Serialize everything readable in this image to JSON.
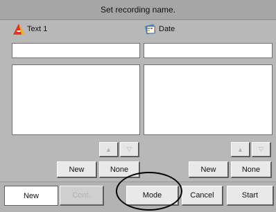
{
  "title": "Set recording name.",
  "left_panel": {
    "label": "Text 1",
    "icon": "text-font-icon",
    "new_label": "New",
    "none_label": "None",
    "up_arrow": "▲",
    "down_arrow": "▽"
  },
  "right_panel": {
    "label": "Date",
    "icon": "calendar-icon",
    "new_label": "New",
    "none_label": "None",
    "up_arrow": "▲",
    "down_arrow": "▽"
  },
  "bottom": {
    "new_label": "New",
    "cont_label": "Cont.",
    "mode_label": "Mode",
    "cancel_label": "Cancel",
    "start_label": "Start"
  },
  "colors": {
    "background": "#b8b8b8",
    "field": "#ffffff",
    "button": "#e9e9e9",
    "text_icon_red": "#e8321e",
    "text_icon_yellow": "#f3b800"
  }
}
